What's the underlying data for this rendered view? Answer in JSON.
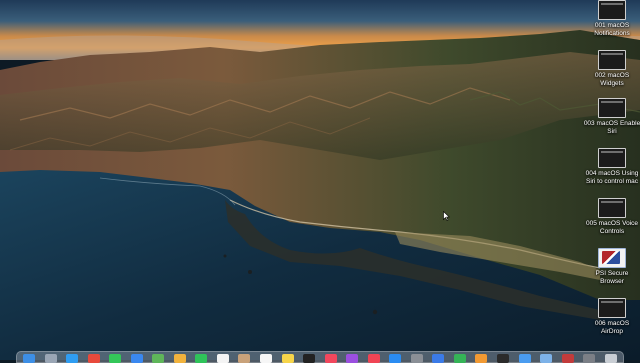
{
  "desktop": {
    "icons": [
      {
        "label_line1": "001 macOS",
        "label_line2": "Notifications",
        "thumb": "video-thumbnail"
      },
      {
        "label_line1": "002 macOS",
        "label_line2": "Widgets",
        "thumb": "video-thumbnail"
      },
      {
        "label_line1": "003 macOS Enable",
        "label_line2": "Siri",
        "thumb": "video-thumbnail"
      },
      {
        "label_line1": "004 macOS Using",
        "label_line2": "Siri to control mac",
        "thumb": "video-thumbnail"
      },
      {
        "label_line1": "005 macOS Voice",
        "label_line2": "Controls",
        "thumb": "video-thumbnail"
      },
      {
        "label_line1": "PSI Secure",
        "label_line2": "Browser",
        "thumb": "app-icon"
      },
      {
        "label_line1": "006 macOS",
        "label_line2": "AirDrop",
        "thumb": "video-thumbnail"
      }
    ]
  },
  "dock": {
    "apps": [
      {
        "name": "finder-app",
        "color": "#3d8fe6"
      },
      {
        "name": "launchpad-app",
        "color": "#9aa6b5"
      },
      {
        "name": "safari-app",
        "color": "#2f9df2"
      },
      {
        "name": "chrome-app",
        "color": "#e84a3c"
      },
      {
        "name": "messages-app",
        "color": "#34c759"
      },
      {
        "name": "mail-app",
        "color": "#3a88f0"
      },
      {
        "name": "maps-app",
        "color": "#5fb65a"
      },
      {
        "name": "photos-app",
        "color": "#f2b33d"
      },
      {
        "name": "facetime-app",
        "color": "#2fc45a"
      },
      {
        "name": "calendar-app",
        "color": "#f4f4f4"
      },
      {
        "name": "contacts-app",
        "color": "#c9a27a"
      },
      {
        "name": "reminders-app",
        "color": "#f6f6f6"
      },
      {
        "name": "notes-app",
        "color": "#f7d54a"
      },
      {
        "name": "tv-app",
        "color": "#222222"
      },
      {
        "name": "music-app",
        "color": "#f2475d"
      },
      {
        "name": "podcasts-app",
        "color": "#9b4fe0"
      },
      {
        "name": "news-app",
        "color": "#f04454"
      },
      {
        "name": "app-store-app",
        "color": "#2a8cf2"
      },
      {
        "name": "system-preferences-app",
        "color": "#8a8f96"
      },
      {
        "name": "keynote-app",
        "color": "#3b7be8"
      },
      {
        "name": "numbers-app",
        "color": "#35b457"
      },
      {
        "name": "pages-app",
        "color": "#f29a33"
      },
      {
        "name": "terminal-app",
        "color": "#2b2b2b"
      },
      {
        "name": "xcode-app",
        "color": "#4a9cf0"
      },
      {
        "name": "preview-app",
        "color": "#7db2e8"
      },
      {
        "name": "psi-browser-app",
        "color": "#c23b3b"
      },
      {
        "name": "screenshot-app",
        "color": "#7b7f86"
      },
      {
        "name": "trash-app",
        "color": "#c9ced4"
      }
    ]
  }
}
